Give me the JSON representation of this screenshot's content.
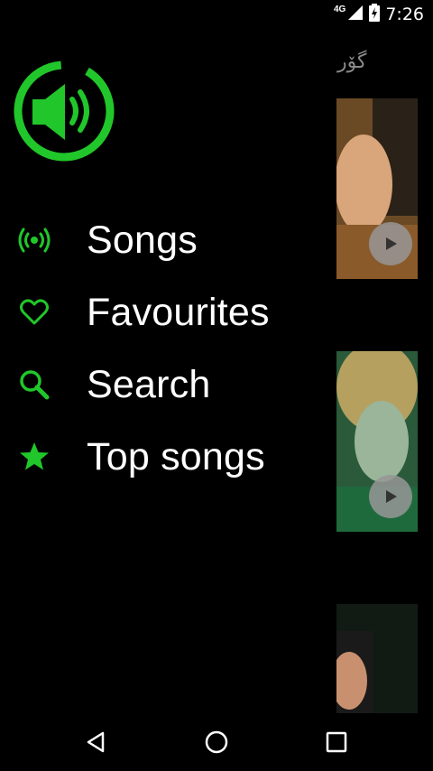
{
  "status_bar": {
    "network": "4G",
    "time": "7:26"
  },
  "background": {
    "header_text": "گۆر"
  },
  "drawer": {
    "menu": [
      {
        "label": "Songs",
        "icon": "radio-signal-icon"
      },
      {
        "label": "Favourites",
        "icon": "heart-icon"
      },
      {
        "label": "Search",
        "icon": "search-icon"
      },
      {
        "label": "Top songs",
        "icon": "star-icon"
      }
    ]
  },
  "colors": {
    "accent": "#21c72a",
    "background": "#000000",
    "text": "#ffffff"
  }
}
